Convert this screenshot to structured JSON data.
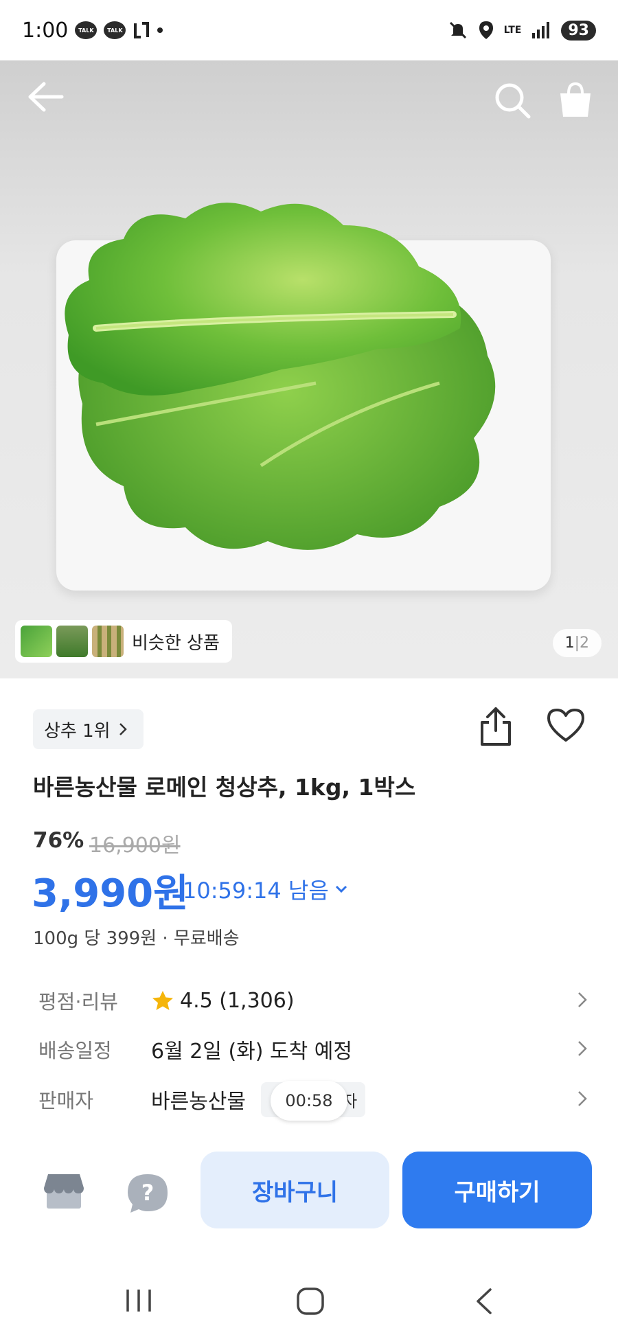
{
  "status_bar": {
    "time": "1:00",
    "talk_badge": "TALK",
    "network": "LTE",
    "battery": "93"
  },
  "hero": {
    "similar_label": "비슷한 상품",
    "pager_current": "1",
    "pager_sep": "|",
    "pager_total": "2"
  },
  "product": {
    "rank_label": "상추 1위",
    "title": "바른농산물 로메인 청상추, 1kg, 1박스",
    "discount": "76%",
    "original_price": "16,900원",
    "price": "3,990원",
    "deal_timer": "10:59:14 남음",
    "unit_price": "100g 당 399원 · 무료배송"
  },
  "details": {
    "rating_label": "평점·리뷰",
    "rating_value": "4.5 (1,306)",
    "delivery_label": "배송일정",
    "delivery_value": "6월 2일 (화) 도착 예정",
    "seller_label": "판매자",
    "seller_value": "바른농산물",
    "seller_badge": "배자"
  },
  "overlay_timer": "00:58",
  "actions": {
    "cart_label": "장바구니",
    "buy_label": "구매하기"
  },
  "colors": {
    "accent": "#2f72e8",
    "buy_button": "#2f7bef",
    "cart_button_bg": "#e4eefc",
    "star": "#f5b50a"
  }
}
